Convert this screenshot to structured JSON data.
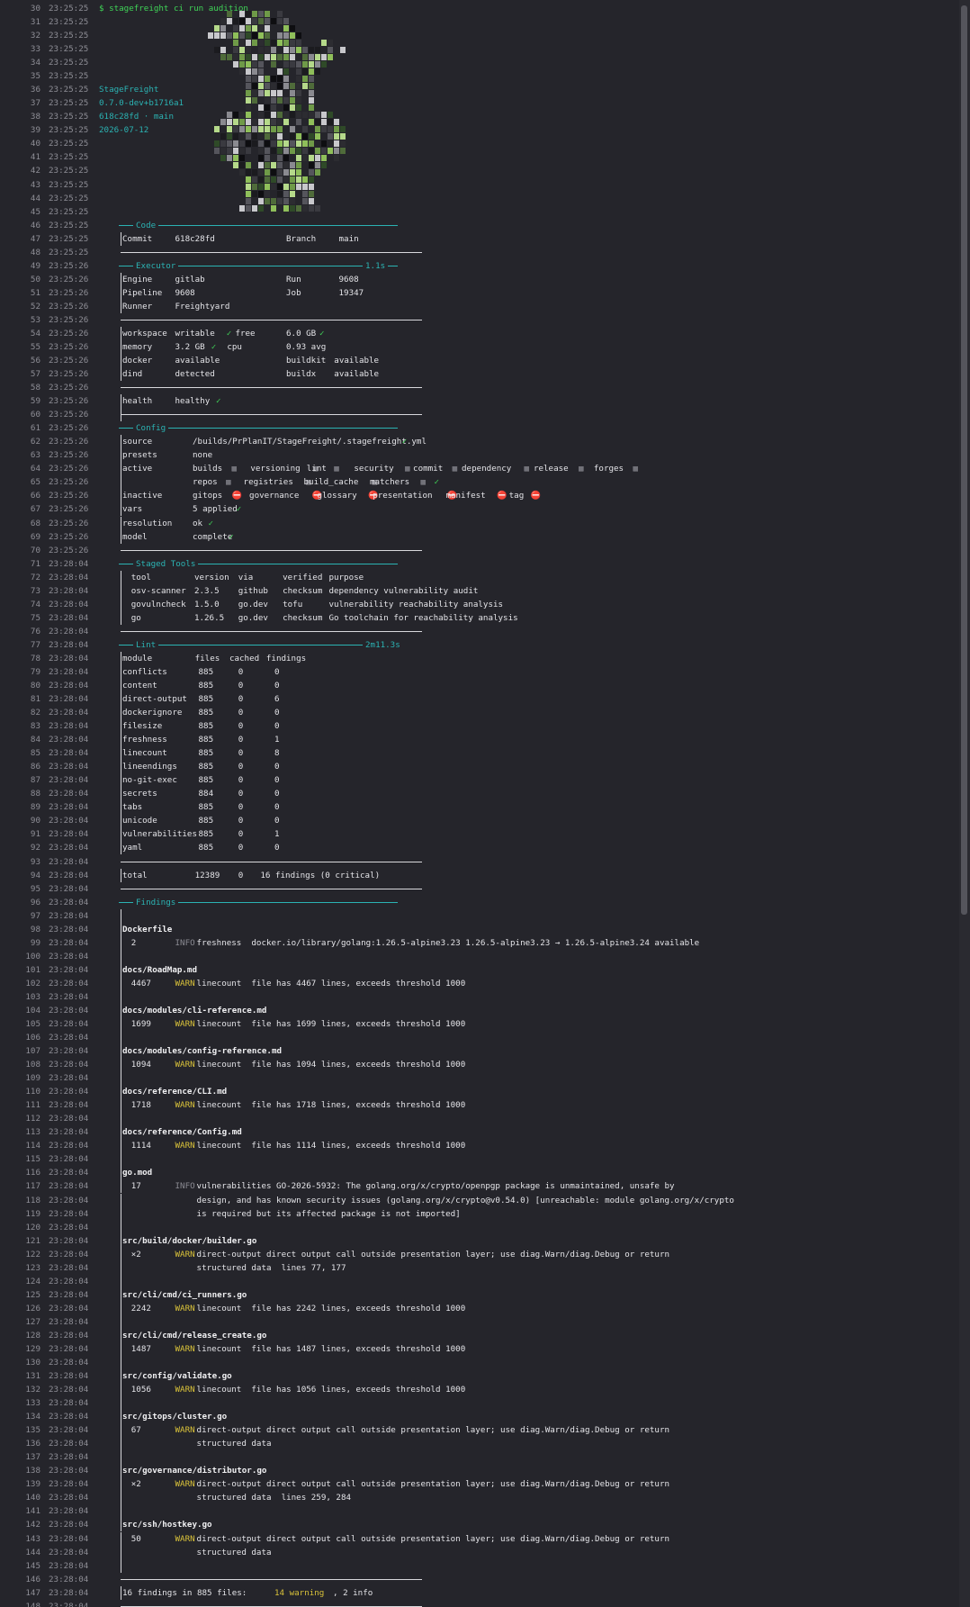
{
  "command": "$ stagefreight ci run audition",
  "logo_icon": "stagefreight-mosaic-logo",
  "brand": {
    "name": "StageFreight",
    "version": "0.7.0-dev+b1716a1",
    "commit": "618c28fd · main",
    "date": "2026-07-12"
  },
  "lines": [
    {
      "n": "30",
      "t": "23:25:25"
    },
    {
      "n": "31",
      "t": "23:25:25"
    },
    {
      "n": "32",
      "t": "23:25:25"
    },
    {
      "n": "33",
      "t": "23:25:25"
    },
    {
      "n": "34",
      "t": "23:25:25"
    },
    {
      "n": "35",
      "t": "23:25:25"
    },
    {
      "n": "36",
      "t": "23:25:25"
    },
    {
      "n": "37",
      "t": "23:25:25"
    },
    {
      "n": "38",
      "t": "23:25:25"
    },
    {
      "n": "39",
      "t": "23:25:25"
    },
    {
      "n": "40",
      "t": "23:25:25"
    },
    {
      "n": "41",
      "t": "23:25:25"
    },
    {
      "n": "42",
      "t": "23:25:25"
    },
    {
      "n": "43",
      "t": "23:25:25"
    },
    {
      "n": "44",
      "t": "23:25:25"
    },
    {
      "n": "45",
      "t": "23:25:25"
    },
    {
      "n": "46",
      "t": "23:25:25"
    },
    {
      "n": "47",
      "t": "23:25:25"
    },
    {
      "n": "48",
      "t": "23:25:25"
    },
    {
      "n": "49",
      "t": "23:25:26"
    },
    {
      "n": "50",
      "t": "23:25:26"
    },
    {
      "n": "51",
      "t": "23:25:26"
    },
    {
      "n": "52",
      "t": "23:25:26"
    },
    {
      "n": "53",
      "t": "23:25:26"
    },
    {
      "n": "54",
      "t": "23:25:26"
    },
    {
      "n": "55",
      "t": "23:25:26"
    },
    {
      "n": "56",
      "t": "23:25:26"
    },
    {
      "n": "57",
      "t": "23:25:26"
    },
    {
      "n": "58",
      "t": "23:25:26"
    },
    {
      "n": "59",
      "t": "23:25:26"
    },
    {
      "n": "60",
      "t": "23:25:26"
    },
    {
      "n": "61",
      "t": "23:25:26"
    },
    {
      "n": "62",
      "t": "23:25:26"
    },
    {
      "n": "63",
      "t": "23:25:26"
    },
    {
      "n": "64",
      "t": "23:25:26"
    },
    {
      "n": "65",
      "t": "23:25:26"
    },
    {
      "n": "66",
      "t": "23:25:26"
    },
    {
      "n": "67",
      "t": "23:25:26"
    },
    {
      "n": "68",
      "t": "23:25:26"
    },
    {
      "n": "69",
      "t": "23:25:26"
    },
    {
      "n": "70",
      "t": "23:25:26"
    },
    {
      "n": "71",
      "t": "23:28:04"
    },
    {
      "n": "72",
      "t": "23:28:04"
    },
    {
      "n": "73",
      "t": "23:28:04"
    },
    {
      "n": "74",
      "t": "23:28:04"
    },
    {
      "n": "75",
      "t": "23:28:04"
    },
    {
      "n": "76",
      "t": "23:28:04"
    },
    {
      "n": "77",
      "t": "23:28:04"
    },
    {
      "n": "78",
      "t": "23:28:04"
    },
    {
      "n": "79",
      "t": "23:28:04"
    },
    {
      "n": "80",
      "t": "23:28:04"
    },
    {
      "n": "81",
      "t": "23:28:04"
    },
    {
      "n": "82",
      "t": "23:28:04"
    },
    {
      "n": "83",
      "t": "23:28:04"
    },
    {
      "n": "84",
      "t": "23:28:04"
    },
    {
      "n": "85",
      "t": "23:28:04"
    },
    {
      "n": "86",
      "t": "23:28:04"
    },
    {
      "n": "87",
      "t": "23:28:04"
    },
    {
      "n": "88",
      "t": "23:28:04"
    },
    {
      "n": "89",
      "t": "23:28:04"
    },
    {
      "n": "90",
      "t": "23:28:04"
    },
    {
      "n": "91",
      "t": "23:28:04"
    },
    {
      "n": "92",
      "t": "23:28:04"
    },
    {
      "n": "93",
      "t": "23:28:04"
    },
    {
      "n": "94",
      "t": "23:28:04"
    },
    {
      "n": "95",
      "t": "23:28:04"
    },
    {
      "n": "96",
      "t": "23:28:04"
    },
    {
      "n": "97",
      "t": "23:28:04"
    },
    {
      "n": "98",
      "t": "23:28:04"
    },
    {
      "n": "99",
      "t": "23:28:04"
    },
    {
      "n": "100",
      "t": "23:28:04"
    },
    {
      "n": "101",
      "t": "23:28:04"
    },
    {
      "n": "102",
      "t": "23:28:04"
    },
    {
      "n": "103",
      "t": "23:28:04"
    },
    {
      "n": "104",
      "t": "23:28:04"
    },
    {
      "n": "105",
      "t": "23:28:04"
    },
    {
      "n": "106",
      "t": "23:28:04"
    },
    {
      "n": "107",
      "t": "23:28:04"
    },
    {
      "n": "108",
      "t": "23:28:04"
    },
    {
      "n": "109",
      "t": "23:28:04"
    },
    {
      "n": "110",
      "t": "23:28:04"
    },
    {
      "n": "111",
      "t": "23:28:04"
    },
    {
      "n": "112",
      "t": "23:28:04"
    },
    {
      "n": "113",
      "t": "23:28:04"
    },
    {
      "n": "114",
      "t": "23:28:04"
    },
    {
      "n": "115",
      "t": "23:28:04"
    },
    {
      "n": "116",
      "t": "23:28:04"
    },
    {
      "n": "117",
      "t": "23:28:04"
    },
    {
      "n": "118",
      "t": "23:28:04"
    },
    {
      "n": "119",
      "t": "23:28:04"
    },
    {
      "n": "120",
      "t": "23:28:04"
    },
    {
      "n": "121",
      "t": "23:28:04"
    },
    {
      "n": "122",
      "t": "23:28:04"
    },
    {
      "n": "123",
      "t": "23:28:04"
    },
    {
      "n": "124",
      "t": "23:28:04"
    },
    {
      "n": "125",
      "t": "23:28:04"
    },
    {
      "n": "126",
      "t": "23:28:04"
    },
    {
      "n": "127",
      "t": "23:28:04"
    },
    {
      "n": "128",
      "t": "23:28:04"
    },
    {
      "n": "129",
      "t": "23:28:04"
    },
    {
      "n": "130",
      "t": "23:28:04"
    },
    {
      "n": "131",
      "t": "23:28:04"
    },
    {
      "n": "132",
      "t": "23:28:04"
    },
    {
      "n": "133",
      "t": "23:28:04"
    },
    {
      "n": "134",
      "t": "23:28:04"
    },
    {
      "n": "135",
      "t": "23:28:04"
    },
    {
      "n": "136",
      "t": "23:28:04"
    },
    {
      "n": "137",
      "t": "23:28:04"
    },
    {
      "n": "138",
      "t": "23:28:04"
    },
    {
      "n": "139",
      "t": "23:28:04"
    },
    {
      "n": "140",
      "t": "23:28:04"
    },
    {
      "n": "141",
      "t": "23:28:04"
    },
    {
      "n": "142",
      "t": "23:28:04"
    },
    {
      "n": "143",
      "t": "23:28:04"
    },
    {
      "n": "144",
      "t": "23:28:04"
    },
    {
      "n": "145",
      "t": "23:28:04"
    },
    {
      "n": "146",
      "t": "23:28:04"
    },
    {
      "n": "147",
      "t": "23:28:04"
    },
    {
      "n": "148",
      "t": "23:28:04"
    }
  ],
  "code": {
    "title": "Code",
    "commit_k": "Commit",
    "commit_v": "618c28fd",
    "branch_k": "Branch",
    "branch_v": "main"
  },
  "executor": {
    "title": "Executor",
    "time": "1.1s",
    "engine_k": "Engine",
    "engine_v": "gitlab",
    "run_k": "Run",
    "run_v": "9608",
    "pipeline_k": "Pipeline",
    "pipeline_v": "9608",
    "job_k": "Job",
    "job_v": "19347",
    "runner_k": "Runner",
    "runner_v": "Freightyard",
    "workspace_k": "workspace",
    "workspace_v": "writable",
    "free_k": "free",
    "free_v": "6.0 GB",
    "memory_k": "memory",
    "memory_v": "3.2 GB",
    "cpu_k": "cpu",
    "cpu_v": "0.93 avg",
    "docker_k": "docker",
    "docker_v": "available",
    "buildkit_k": "buildkit",
    "buildkit_v": "available",
    "dind_k": "dind",
    "dind_v": "detected",
    "buildx_k": "buildx",
    "buildx_v": "available",
    "health_k": "health",
    "health_v": "healthy",
    "check": "✓"
  },
  "config": {
    "title": "Config",
    "source_k": "source",
    "source_v": "/builds/PrPlanIT/StageFreight/.stagefreight.yml",
    "presets_k": "presets",
    "presets_v": "none",
    "active_k": "active",
    "active1": [
      "builds",
      "versioning",
      "lint",
      "security",
      "commit",
      "dependency",
      "release",
      "forges"
    ],
    "active2": [
      "repos",
      "registries",
      "build_cache",
      "matchers"
    ],
    "flag": "▦",
    "inactive_k": "inactive",
    "inactive": [
      "gitops",
      "governance",
      "glossary",
      "presentation",
      "manifest",
      "tag"
    ],
    "stop": "⛔",
    "vars_k": "vars",
    "vars_v": "5 applied",
    "resolution_k": "resolution",
    "resolution_v": "ok",
    "model_k": "model",
    "model_v": "complete"
  },
  "tools": {
    "title": "Staged Tools",
    "headers": [
      "tool",
      "version",
      "via",
      "verified",
      "purpose"
    ],
    "rows": [
      [
        "osv-scanner",
        "2.3.5",
        "github",
        "checksum",
        "dependency vulnerability audit"
      ],
      [
        "govulncheck",
        "1.5.0",
        "go.dev",
        "tofu",
        "vulnerability reachability analysis"
      ],
      [
        "go",
        "1.26.5",
        "go.dev",
        "checksum",
        "Go toolchain for reachability analysis"
      ]
    ]
  },
  "lint": {
    "title": "Lint",
    "time": "2m11.3s",
    "headers": [
      "module",
      "files",
      "cached",
      "findings"
    ],
    "rows": [
      [
        "conflicts",
        "885",
        "0",
        "0"
      ],
      [
        "content",
        "885",
        "0",
        "0"
      ],
      [
        "direct-output",
        "885",
        "0",
        "6"
      ],
      [
        "dockerignore",
        "885",
        "0",
        "0"
      ],
      [
        "filesize",
        "885",
        "0",
        "0"
      ],
      [
        "freshness",
        "885",
        "0",
        "1"
      ],
      [
        "linecount",
        "885",
        "0",
        "8"
      ],
      [
        "lineendings",
        "885",
        "0",
        "0"
      ],
      [
        "no-git-exec",
        "885",
        "0",
        "0"
      ],
      [
        "secrets",
        "884",
        "0",
        "0"
      ],
      [
        "tabs",
        "885",
        "0",
        "0"
      ],
      [
        "unicode",
        "885",
        "0",
        "0"
      ],
      [
        "vulnerabilities",
        "885",
        "0",
        "1"
      ],
      [
        "yaml",
        "885",
        "0",
        "0"
      ]
    ],
    "total": [
      "total",
      "12389",
      "0",
      "16 findings (0 critical)"
    ]
  },
  "findings": {
    "title": "Findings",
    "items": [
      {
        "file": "Dockerfile",
        "lines": [
          {
            "a": "2",
            "lvl": "INFO",
            "msg": "freshness  docker.io/library/golang:1.26.5-alpine3.23 1.26.5-alpine3.23 → 1.26.5-alpine3.24 available"
          }
        ]
      },
      {
        "file": "docs/RoadMap.md",
        "lines": [
          {
            "a": "4467",
            "lvl": "WARN",
            "msg": "linecount  file has 4467 lines, exceeds threshold 1000"
          }
        ]
      },
      {
        "file": "docs/modules/cli-reference.md",
        "lines": [
          {
            "a": "1699",
            "lvl": "WARN",
            "msg": "linecount  file has 1699 lines, exceeds threshold 1000"
          }
        ]
      },
      {
        "file": "docs/modules/config-reference.md",
        "lines": [
          {
            "a": "1094",
            "lvl": "WARN",
            "msg": "linecount  file has 1094 lines, exceeds threshold 1000"
          }
        ]
      },
      {
        "file": "docs/reference/CLI.md",
        "lines": [
          {
            "a": "1718",
            "lvl": "WARN",
            "msg": "linecount  file has 1718 lines, exceeds threshold 1000"
          }
        ]
      },
      {
        "file": "docs/reference/Config.md",
        "lines": [
          {
            "a": "1114",
            "lvl": "WARN",
            "msg": "linecount  file has 1114 lines, exceeds threshold 1000"
          }
        ]
      },
      {
        "file": "go.mod",
        "lines": [
          {
            "a": "17",
            "lvl": "INFO",
            "msg": "vulnerabilities GO-2026-5932: The golang.org/x/crypto/openpgp package is unmaintained, unsafe by"
          },
          {
            "a": "",
            "lvl": "",
            "msg": "design, and has known security issues (golang.org/x/crypto@v0.54.0) [unreachable: module golang.org/x/crypto"
          },
          {
            "a": "",
            "lvl": "",
            "msg": "is required but its affected package is not imported]"
          }
        ]
      },
      {
        "file": "src/build/docker/builder.go",
        "lines": [
          {
            "a": "×2",
            "lvl": "WARN",
            "msg": "direct-output direct output call outside presentation layer; use diag.Warn/diag.Debug or return"
          },
          {
            "a": "",
            "lvl": "",
            "msg": "structured data  lines 77, 177"
          }
        ]
      },
      {
        "file": "src/cli/cmd/ci_runners.go",
        "lines": [
          {
            "a": "2242",
            "lvl": "WARN",
            "msg": "linecount  file has 2242 lines, exceeds threshold 1000"
          }
        ]
      },
      {
        "file": "src/cli/cmd/release_create.go",
        "lines": [
          {
            "a": "1487",
            "lvl": "WARN",
            "msg": "linecount  file has 1487 lines, exceeds threshold 1000"
          }
        ]
      },
      {
        "file": "src/config/validate.go",
        "lines": [
          {
            "a": "1056",
            "lvl": "WARN",
            "msg": "linecount  file has 1056 lines, exceeds threshold 1000"
          }
        ]
      },
      {
        "file": "src/gitops/cluster.go",
        "lines": [
          {
            "a": "67",
            "lvl": "WARN",
            "msg": "direct-output direct output call outside presentation layer; use diag.Warn/diag.Debug or return"
          },
          {
            "a": "",
            "lvl": "",
            "msg": "structured data"
          }
        ]
      },
      {
        "file": "src/governance/distributor.go",
        "lines": [
          {
            "a": "×2",
            "lvl": "WARN",
            "msg": "direct-output direct output call outside presentation layer; use diag.Warn/diag.Debug or return"
          },
          {
            "a": "",
            "lvl": "",
            "msg": "structured data  lines 259, 284"
          }
        ]
      },
      {
        "file": "src/ssh/hostkey.go",
        "lines": [
          {
            "a": "50",
            "lvl": "WARN",
            "msg": "direct-output direct output call outside presentation layer; use diag.Warn/diag.Debug or return"
          },
          {
            "a": "",
            "lvl": "",
            "msg": "structured data"
          }
        ]
      }
    ],
    "summary_a": "16 findings in 885 files: ",
    "summary_w": "14 warning",
    "summary_b": ", 2 info"
  },
  "colors": {
    "bg": "#25252b",
    "green": "#3fd457",
    "cyan": "#2bb3b3",
    "yellow": "#d9c23a",
    "red": "#e0453f"
  }
}
